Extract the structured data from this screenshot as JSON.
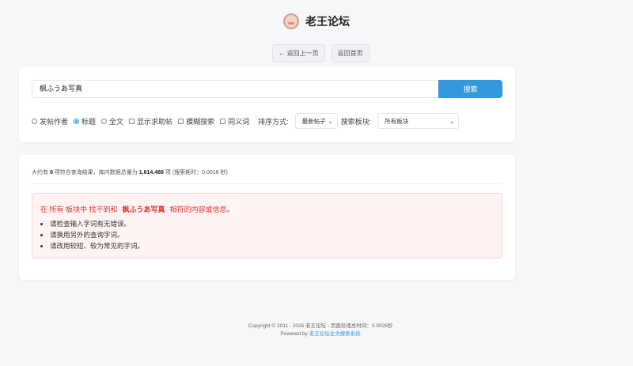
{
  "header": {
    "title": "老王论坛"
  },
  "nav": {
    "back": "← 返回上一页",
    "home": "返回首页"
  },
  "search": {
    "value": "枫ふうあ写真",
    "button": "搜索"
  },
  "options": {
    "author": "发帖作者",
    "title": "标题",
    "fulltext": "全文",
    "show_help": "显示求助帖",
    "fuzzy": "模糊搜索",
    "synonym": "同义词",
    "sort_label": "排序方式:",
    "sort_value": "最新帖子",
    "board_label": "搜索板块:",
    "board_value": "所有板块",
    "selected": "标题"
  },
  "results": {
    "pre": "大约有",
    "count": "0",
    "mid": "项符合查询结果，库内数据总量为",
    "total": "1,614,488",
    "post": "项 (搜索耗时：0.0016 秒)"
  },
  "alert": {
    "p1": "在 所有 板块中 找不到和",
    "term": "枫ふうあ写真",
    "p2": "相符的内容或信息。",
    "tips": [
      "请检查输入字词有无错误。",
      "请换用另外的查询字词。",
      "请改用较短、较为常见的字词。"
    ]
  },
  "footer": {
    "copyright": "Copyright © 2011 - 2025 老王论坛 - 页面处理总时间：0.0026秒",
    "powered": "Powered by",
    "link": "老王论坛全文搜索系统"
  }
}
